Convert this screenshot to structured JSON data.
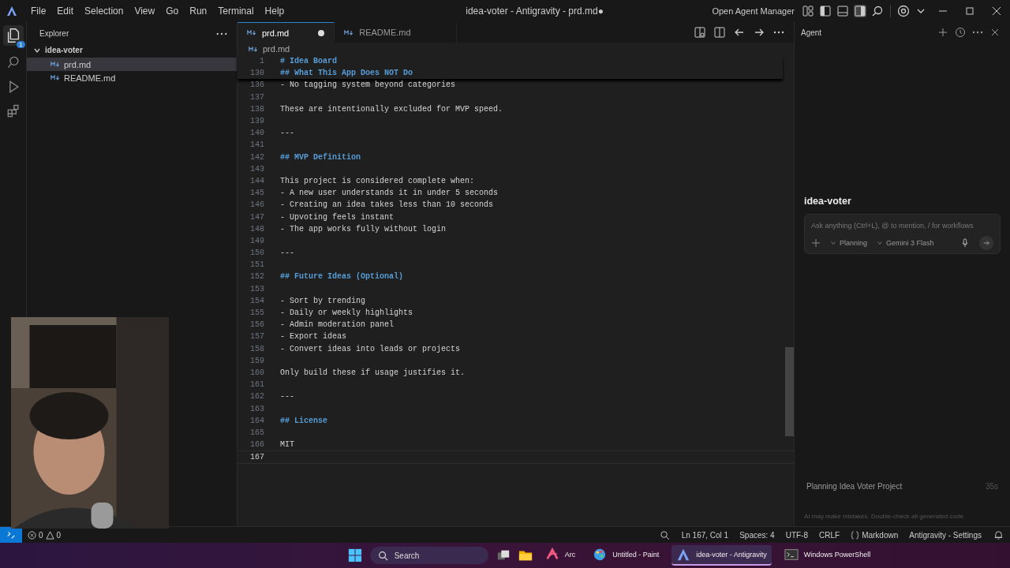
{
  "window": {
    "title": "idea-voter - Antigravity - prd.md●",
    "menu": [
      "File",
      "Edit",
      "Selection",
      "View",
      "Go",
      "Run",
      "Terminal",
      "Help"
    ],
    "agent_manager": "Open Agent Manager"
  },
  "activity_bar": {
    "badge": "1"
  },
  "explorer": {
    "title": "Explorer",
    "folder": {
      "name": "idea-voter",
      "expanded": true,
      "children": [
        {
          "name": "prd.md",
          "selected": true
        },
        {
          "name": "README.md",
          "selected": false
        }
      ]
    }
  },
  "tabs": [
    {
      "label": "prd.md",
      "selected": true,
      "modified": true
    },
    {
      "label": "README.md",
      "selected": false,
      "modified": false
    }
  ],
  "breadcrumb": "prd.md",
  "sticky": [
    {
      "number": "1",
      "text": "# Idea Board"
    },
    {
      "number": "130",
      "text": "## What This App Does NOT Do"
    }
  ],
  "lines": [
    {
      "number": "136",
      "kind": "text",
      "text": "- No tagging system beyond categories"
    },
    {
      "number": "137",
      "kind": "text"
    },
    {
      "number": "138",
      "kind": "text",
      "text": "These are intentionally excluded for MVP speed."
    },
    {
      "number": "139",
      "kind": "text"
    },
    {
      "number": "140",
      "kind": "text",
      "text": "---"
    },
    {
      "number": "141",
      "kind": "text"
    },
    {
      "number": "142",
      "kind": "heading",
      "text": "## MVP Definition"
    },
    {
      "number": "143",
      "kind": "text"
    },
    {
      "number": "144",
      "kind": "text",
      "text": "This project is considered complete when:"
    },
    {
      "number": "145",
      "kind": "text",
      "text": "- A new user understands it in under 5 seconds"
    },
    {
      "number": "146",
      "kind": "text",
      "text": "- Creating an idea takes less than 10 seconds"
    },
    {
      "number": "147",
      "kind": "text",
      "text": "- Upvoting feels instant"
    },
    {
      "number": "148",
      "kind": "text",
      "text": "- The app works fully without login"
    },
    {
      "number": "149",
      "kind": "text"
    },
    {
      "number": "150",
      "kind": "text",
      "text": "---"
    },
    {
      "number": "151",
      "kind": "text"
    },
    {
      "number": "152",
      "kind": "heading",
      "text": "## Future Ideas (Optional)"
    },
    {
      "number": "153",
      "kind": "text"
    },
    {
      "number": "154",
      "kind": "text",
      "text": "- Sort by trending"
    },
    {
      "number": "155",
      "kind": "text",
      "text": "- Daily or weekly highlights"
    },
    {
      "number": "156",
      "kind": "text",
      "text": "- Admin moderation panel"
    },
    {
      "number": "157",
      "kind": "text",
      "text": "- Export ideas"
    },
    {
      "number": "158",
      "kind": "text",
      "text": "- Convert ideas into leads or projects"
    },
    {
      "number": "159",
      "kind": "text"
    },
    {
      "number": "160",
      "kind": "text",
      "text": "Only build these if usage justifies it."
    },
    {
      "number": "161",
      "kind": "text"
    },
    {
      "number": "162",
      "kind": "text",
      "text": "---"
    },
    {
      "number": "163",
      "kind": "text"
    },
    {
      "number": "164",
      "kind": "heading",
      "text": "## License"
    },
    {
      "number": "165",
      "kind": "text"
    },
    {
      "number": "166",
      "kind": "text",
      "text": "MIT"
    },
    {
      "number": "167",
      "kind": "current"
    }
  ],
  "agent": {
    "title": "Agent",
    "project": "idea-voter",
    "placeholder": "Ask anything (Ctrl+L), @ to mention, / for workflows",
    "mode": "Planning",
    "model": "Gemini 3 Flash",
    "conversation": {
      "title": "Planning Idea Voter Project",
      "time": "35s"
    },
    "disclaimer": "AI may make mistakes. Double-check all generated code."
  },
  "status_bar": {
    "errors": "0",
    "warnings": "0",
    "position": "Ln 167, Col 1",
    "spaces": "Spaces: 4",
    "encoding": "UTF-8",
    "eol": "CRLF",
    "language": "Markdown",
    "settings": "Antigravity - Settings"
  },
  "taskbar": {
    "search": "Search",
    "apps": [
      {
        "label": "Arc",
        "kind": "arc",
        "selected": false
      },
      {
        "label": "Untitled - Paint",
        "kind": "paint",
        "selected": false
      },
      {
        "label": "idea-voter - Antigravity",
        "kind": "antigravity",
        "selected": true
      },
      {
        "label": "Windows PowerShell",
        "kind": "terminal",
        "selected": false
      }
    ]
  }
}
